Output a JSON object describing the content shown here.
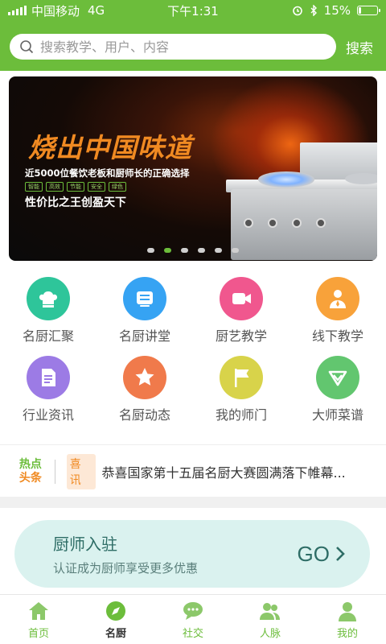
{
  "status_bar": {
    "carrier": "中国移动",
    "network": "4G",
    "time": "下午1:31",
    "battery": "15%",
    "battery_level": 0.15
  },
  "search": {
    "placeholder": "搜索教学、用户、内容",
    "button_label": "搜索"
  },
  "banner": {
    "title": "烧出中国味道",
    "subtitle": "近5000位餐饮老板和厨师长的正确选择",
    "tags": [
      "智能",
      "高效",
      "节能",
      "安全",
      "绿色"
    ],
    "slogan": "性价比之王创盈天下",
    "page_count": 6,
    "active_page": 2
  },
  "grid": {
    "items": [
      {
        "label": "名厨汇聚",
        "icon": "chef-hat-icon",
        "color": "#2ec59a"
      },
      {
        "label": "名厨讲堂",
        "icon": "lecture-icon",
        "color": "#36a3f3"
      },
      {
        "label": "厨艺教学",
        "icon": "video-icon",
        "color": "#f0578e"
      },
      {
        "label": "线下教学",
        "icon": "teacher-icon",
        "color": "#f8a23a"
      },
      {
        "label": "行业资讯",
        "icon": "document-icon",
        "color": "#9c7be5"
      },
      {
        "label": "名厨动态",
        "icon": "star-icon",
        "color": "#f07a4b"
      },
      {
        "label": "我的师门",
        "icon": "flag-icon",
        "color": "#d8d34a"
      },
      {
        "label": "大师菜谱",
        "icon": "recipe-icon",
        "color": "#62c66f"
      }
    ]
  },
  "news": {
    "logo_line1": "热点",
    "logo_line2": "头条",
    "badge": "喜讯",
    "text": "恭喜国家第十五届名厨大赛圆满落下帷幕..."
  },
  "chef_join": {
    "title": "厨师入驻",
    "subtitle": "认证成为厨师享受更多优惠",
    "go_label": "GO"
  },
  "tabs": [
    {
      "label": "首页",
      "icon": "home-icon",
      "active": false
    },
    {
      "label": "名厨",
      "icon": "compass-icon",
      "active": true
    },
    {
      "label": "社交",
      "icon": "chat-icon",
      "active": false
    },
    {
      "label": "人脉",
      "icon": "contacts-icon",
      "active": false
    },
    {
      "label": "我的",
      "icon": "profile-icon",
      "active": false
    }
  ],
  "colors": {
    "brand_green": "#6cbd3b",
    "accent_orange": "#f08a22",
    "chef_banner_bg": "#daf2ef"
  }
}
